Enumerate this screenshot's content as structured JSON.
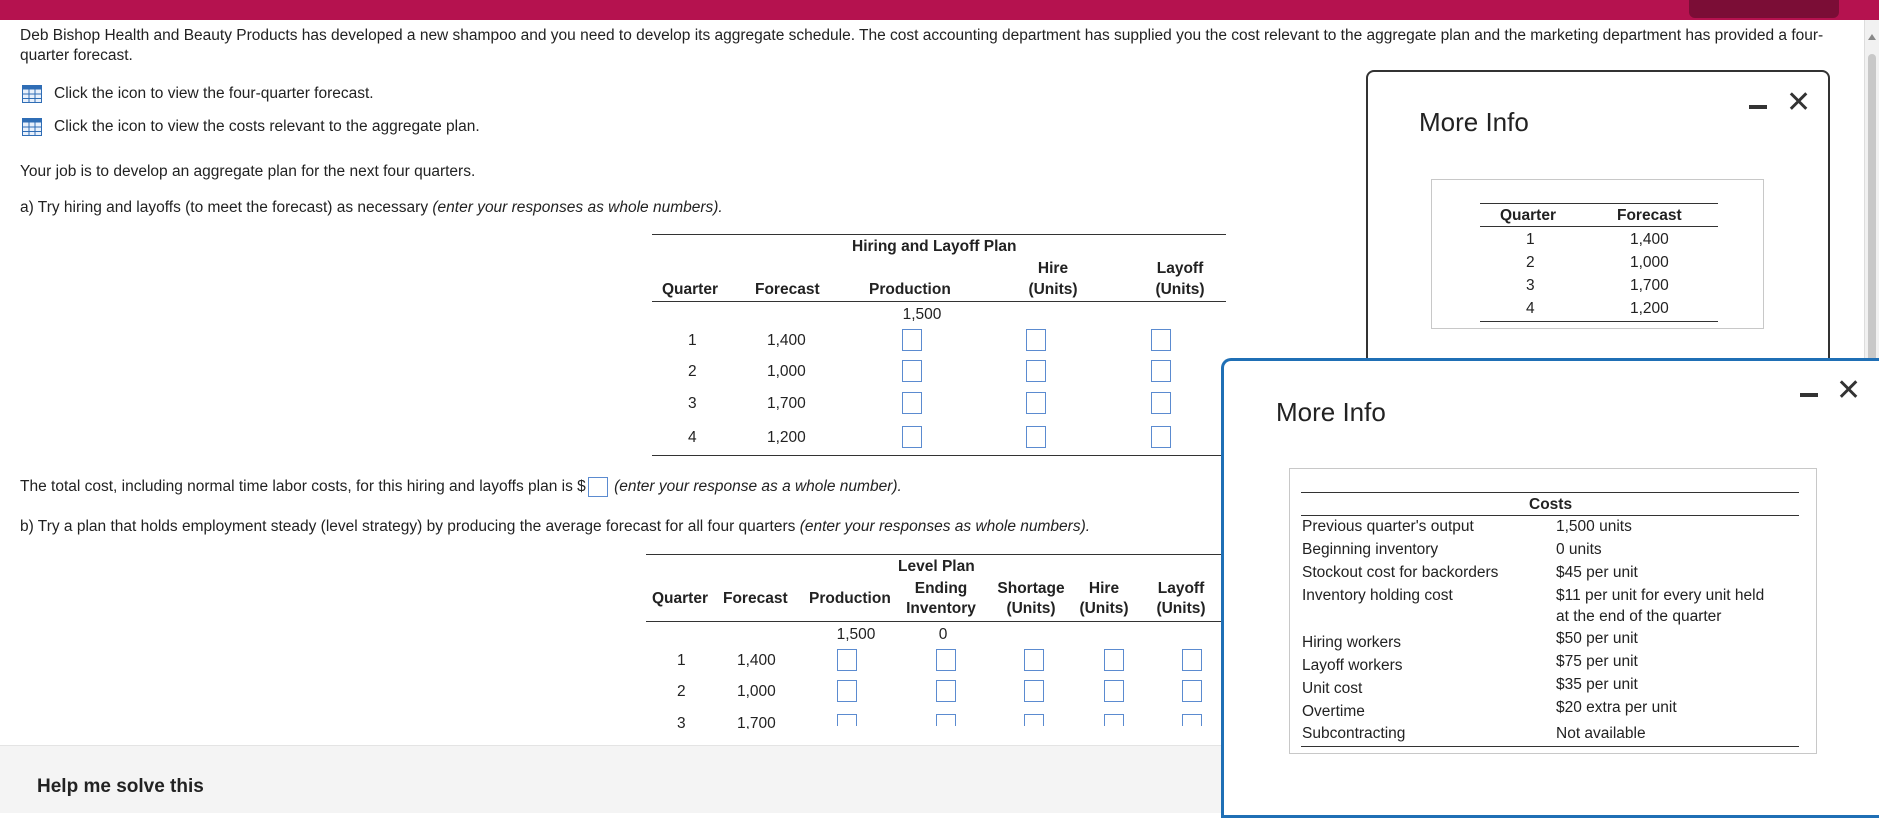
{
  "intro": "Deb Bishop Health and Beauty Products has developed a new shampoo and you need to develop its aggregate schedule. The cost accounting department has supplied you the cost relevant to the aggregate plan and the marketing department has provided a four-quarter forecast.",
  "links": {
    "forecast": "Click the icon to view the four-quarter forecast.",
    "costs": "Click the icon to view the costs relevant to the aggregate plan."
  },
  "job": "Your job is to develop an aggregate plan for the next four quarters.",
  "part_a": {
    "prompt": "a) Try hiring and layoffs (to meet the forecast) as necessary",
    "prompt_note": "(enter your responses as whole numbers).",
    "table_title": "Hiring and Layoff Plan",
    "headers": {
      "quarter": "Quarter",
      "forecast": "Forecast",
      "production": "Production",
      "hire_line1": "Hire",
      "hire_line2": "(Units)",
      "layoff_line1": "Layoff",
      "layoff_line2": "(Units)"
    },
    "initial_production": "1,500",
    "rows": [
      {
        "quarter": "1",
        "forecast": "1,400"
      },
      {
        "quarter": "2",
        "forecast": "1,000"
      },
      {
        "quarter": "3",
        "forecast": "1,700"
      },
      {
        "quarter": "4",
        "forecast": "1,200"
      }
    ],
    "total_text": "The total cost, including normal time labor costs, for this hiring and layoffs plan is $",
    "total_note": "(enter your response as a whole number)."
  },
  "part_b": {
    "prompt": "b) Try a plan that holds employment steady (level strategy) by producing the average forecast for all four quarters",
    "prompt_note": "(enter your responses as whole numbers).",
    "table_title": "Level Plan",
    "headers": {
      "quarter": "Quarter",
      "forecast": "Forecast",
      "production": "Production",
      "ending_line1": "Ending",
      "ending_line2": "Inventory",
      "shortage_line1": "Shortage",
      "shortage_line2": "(Units)",
      "hire_line1": "Hire",
      "hire_line2": "(Units)",
      "layoff_line1": "Layoff",
      "layoff_line2": "(Units)"
    },
    "initial_production": "1,500",
    "initial_inventory": "0",
    "rows": [
      {
        "quarter": "1",
        "forecast": "1,400"
      },
      {
        "quarter": "2",
        "forecast": "1,000"
      },
      {
        "quarter": "3",
        "forecast": "1,700"
      }
    ]
  },
  "help_button": "Help me solve this",
  "popup_forecast": {
    "title": "More Info",
    "headers": {
      "quarter": "Quarter",
      "forecast": "Forecast"
    },
    "rows": [
      {
        "quarter": "1",
        "forecast": "1,400"
      },
      {
        "quarter": "2",
        "forecast": "1,000"
      },
      {
        "quarter": "3",
        "forecast": "1,700"
      },
      {
        "quarter": "4",
        "forecast": "1,200"
      }
    ]
  },
  "popup_costs": {
    "title": "More Info",
    "header": "Costs",
    "rows": [
      {
        "label": "Previous quarter's output",
        "value": "1,500 units"
      },
      {
        "label": "Beginning inventory",
        "value": "0 units"
      },
      {
        "label": "Stockout cost for backorders",
        "value": "$45 per unit"
      },
      {
        "label": "Inventory holding cost",
        "value": "$11 per unit for every unit held",
        "value2": "at the end of the quarter"
      },
      {
        "label": "Hiring workers",
        "value": "$50 per unit"
      },
      {
        "label": "Layoff workers",
        "value": "$75 per unit"
      },
      {
        "label": "Unit cost",
        "value": "$35 per unit"
      },
      {
        "label": "Overtime",
        "value": "$20 extra per unit"
      },
      {
        "label": "Subcontracting",
        "value": "Not available"
      }
    ]
  },
  "colors": {
    "brand": "#b5124f",
    "input_border": "#5b8bd0",
    "popup_border_active": "#1f6fb5"
  }
}
